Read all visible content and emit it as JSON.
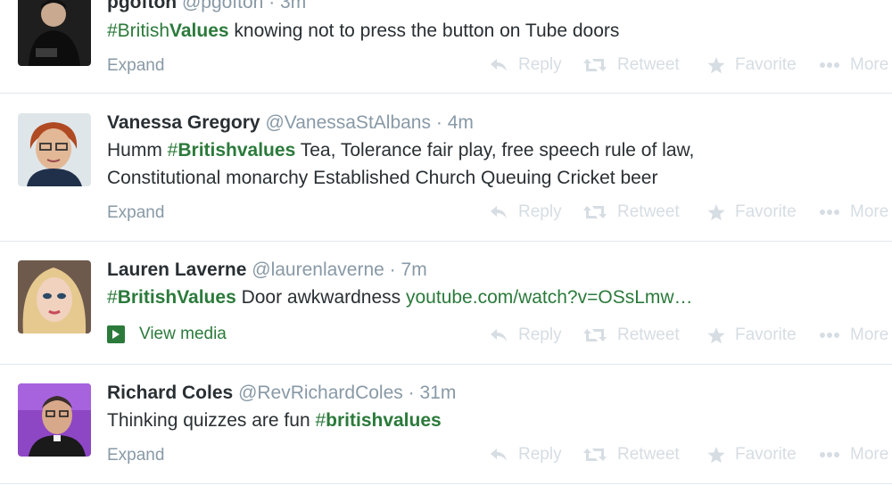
{
  "actions": {
    "reply": "Reply",
    "retweet": "Retweet",
    "favorite": "Favorite",
    "more": "More"
  },
  "tweets": [
    {
      "name": "pgofton",
      "handle": "@pgofton",
      "time": "3m",
      "hashtag": "#British",
      "hashtag_bold": "Values",
      "text_after": " knowing not to press the button on Tube doors",
      "footer": "Expand"
    },
    {
      "name": "Vanessa Gregory",
      "handle": "@VanessaStAlbans",
      "time": "4m",
      "text_before": "Humm ",
      "hashtag": "#",
      "hashtag_bold": "Britishvalues",
      "text_after": " Tea, Tolerance fair play, free speech rule of law,",
      "line2": "Constitutional monarchy Established Church Queuing Cricket beer",
      "footer": "Expand"
    },
    {
      "name": "Lauren Laverne",
      "handle": "@laurenlaverne",
      "time": "7m",
      "hashtag": "#",
      "hashtag_bold": "BritishValues",
      "text_after": " Door awkwardness ",
      "link": "youtube.com/watch?v=OSsLmw…",
      "footer": "View media"
    },
    {
      "name": "Richard Coles",
      "handle": "@RevRichardColes",
      "time": "31m",
      "text_before": "Thinking quizzes are fun ",
      "hashtag": "#",
      "hashtag_bold": "britishvalues",
      "footer": "Expand"
    }
  ],
  "separator": "·",
  "colors": {
    "hashtag": "#2b7a3b",
    "muted": "#8899a6",
    "action": "#d6dde3"
  }
}
